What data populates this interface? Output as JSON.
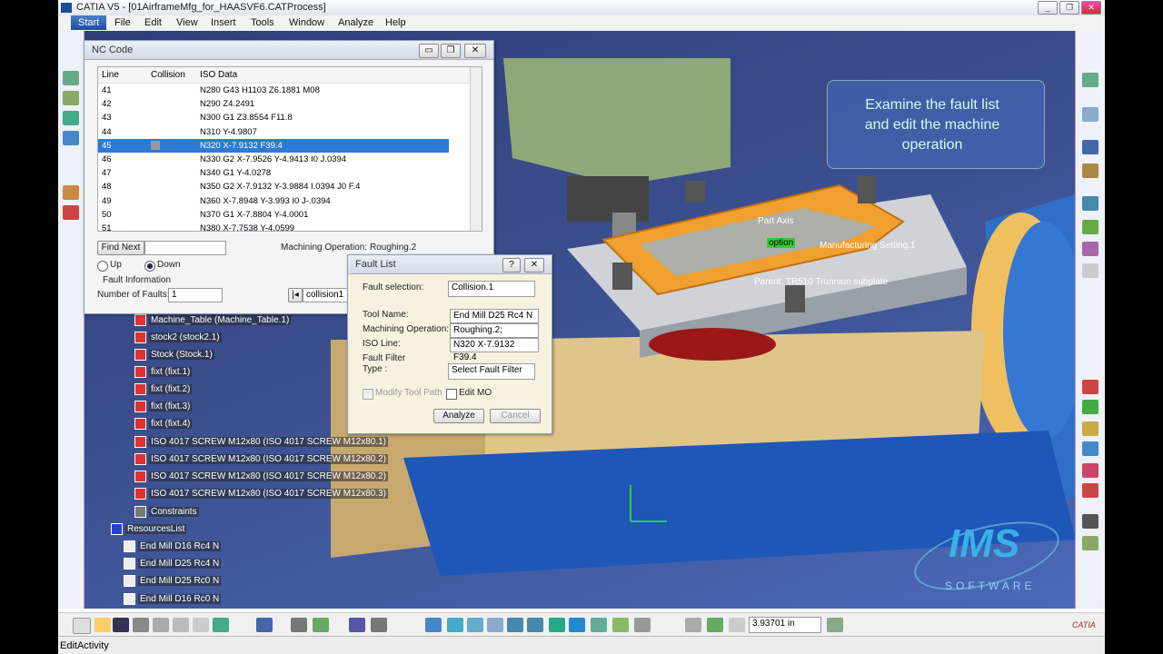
{
  "window": {
    "title": "CATIA V5 - [01AirframeMfg_for_HAASVF6.CATProcess]"
  },
  "menu": {
    "start": "Start",
    "items": [
      "File",
      "Edit",
      "View",
      "Insert",
      "Tools",
      "Window",
      "Analyze",
      "Help"
    ]
  },
  "nc_code": {
    "title": "NC Code",
    "columns": {
      "line": "Line",
      "collision": "Collision",
      "iso": "ISO Data"
    },
    "rows": [
      {
        "line": "41",
        "iso": "N280 G43 H1103 Z6.1881 M08"
      },
      {
        "line": "42",
        "iso": "N290 Z4.2491"
      },
      {
        "line": "43",
        "iso": "N300 G1 Z3.8554 F11.8"
      },
      {
        "line": "44",
        "iso": "N310 Y-4.9807"
      },
      {
        "line": "45",
        "iso": "N320 X-7.9132 F39.4",
        "selected": true
      },
      {
        "line": "46",
        "iso": "N330 G2 X-7.9526 Y-4.9413 I0 J.0394"
      },
      {
        "line": "47",
        "iso": "N340 G1 Y-4.0278"
      },
      {
        "line": "48",
        "iso": "N350 G2 X-7.9132 Y-3.9884 I.0394 J0 F.4"
      },
      {
        "line": "49",
        "iso": "N360 X-7.8948 Y-3.993 I0 J-.0394"
      },
      {
        "line": "50",
        "iso": "N370 G1 X-7.8804 Y-4.0001"
      },
      {
        "line": "51",
        "iso": "N380 X-7.7538 Y-4.0599"
      }
    ],
    "find_next": "Find Next",
    "machining_operation_label": "Machining Operation:",
    "machining_operation_value": "Roughing.2",
    "up": "Up",
    "down": "Down",
    "fault_information": "Fault Information",
    "number_of_faults_label": "Number of Faults:",
    "number_of_faults": "1",
    "collision_value": "collision1"
  },
  "fault_list": {
    "title": "Fault List",
    "fault_selection_label": "Fault selection:",
    "fault_selection_value": "Collision.1",
    "tool_name_label": "Tool Name:",
    "tool_name_value": "End Mill D25 Rc4 N",
    "machining_operation_label": "Machining Operation:",
    "machining_operation_value": "Roughing.2;",
    "iso_line_label": "ISO Line:",
    "iso_line_value": "N320 X-7.9132 F39.4",
    "fault_filter_type_label1": "Fault Filter",
    "fault_filter_type_label2": "Type :",
    "fault_filter_value": "Select Fault Filter",
    "modify_tool_path": "Modify Tool Path",
    "edit_mo": "Edit MO",
    "analyze": "Analyze",
    "cancel": "Cancel"
  },
  "tree": {
    "items": [
      "Machine_Table (Machine_Table.1)",
      "stock2 (stock2.1)",
      "Stock (Stock.1)",
      "fixt (fixt.1)",
      "fixt (fixt.2)",
      "fixt (fixt.3)",
      "fixt (fixt.4)",
      "ISO 4017 SCREW M12x80 (ISO 4017 SCREW M12x80.1)",
      "ISO 4017 SCREW M12x80 (ISO 4017 SCREW M12x80.2)",
      "ISO 4017 SCREW M12x80 (ISO 4017 SCREW M12x80.2)",
      "ISO 4017 SCREW M12x80 (ISO 4017 SCREW M12x80.3)",
      "Constraints"
    ],
    "resources": "ResourcesList",
    "tools": [
      "End Mill D16 Rc4 N",
      "End Mill D25 Rc4 N",
      "End Mill D25 Rc0 N",
      "End Mill D16 Rc0 N"
    ]
  },
  "scene": {
    "callout": "Examine the fault list and edit the machine operation",
    "label_part": "Part Axis",
    "label_setting": "Manufacturing Setting.1",
    "label_parent": "Parent: TR510 Trunnion subplate",
    "label_option": "option",
    "brand": "IMS",
    "brand_sub": "SOFTWARE"
  },
  "bottom": {
    "value": "3.93701 in",
    "status": "EditActivity",
    "logo": "CATIA"
  },
  "colors": {
    "selection": "#2b7bd4",
    "part": "#e8a030",
    "accent_blue": "#2a5eb8"
  }
}
